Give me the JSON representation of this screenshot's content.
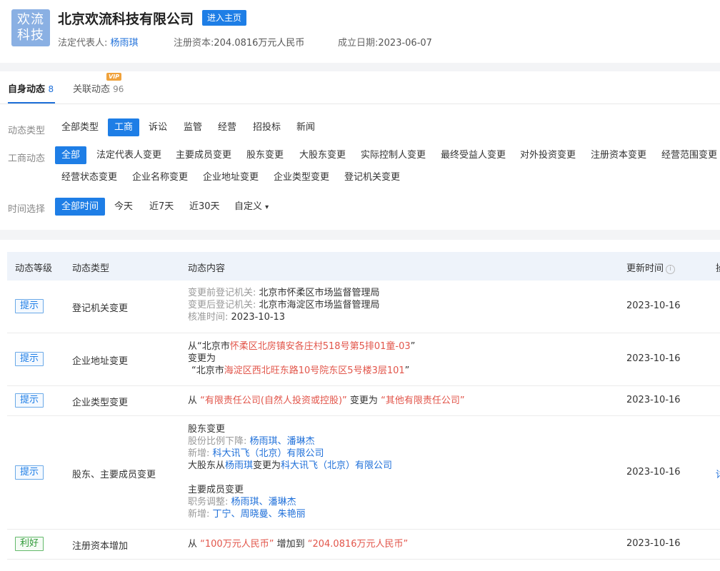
{
  "company": {
    "logo_line1": "欢流",
    "logo_line2": "科技",
    "name": "北京欢流科技有限公司",
    "home_button": "进入主页",
    "legal_rep_label": "法定代表人:",
    "legal_rep": "杨雨琪",
    "capital_label": "注册资本:",
    "capital": "204.0816万元人民币",
    "founded_label": "成立日期:",
    "founded": "2023-06-07"
  },
  "tabs": [
    {
      "label": "自身动态",
      "count": "8"
    },
    {
      "label": "关联动态",
      "count": "96",
      "badge": "VIP"
    }
  ],
  "filters": {
    "type_label": "动态类型",
    "types": [
      "全部类型",
      "工商",
      "诉讼",
      "监管",
      "经营",
      "招投标",
      "新闻"
    ],
    "type_selected": "工商",
    "biz_label": "工商动态",
    "biz_items": [
      "全部",
      "法定代表人变更",
      "主要成员变更",
      "股东变更",
      "大股东变更",
      "实际控制人变更",
      "最终受益人变更",
      "对外投资变更",
      "注册资本变更",
      "经营范围变更",
      "经营状态变更",
      "企业名称变更",
      "企业地址变更",
      "企业类型变更",
      "登记机关变更"
    ],
    "biz_selected": "全部",
    "time_label": "时间选择",
    "times": [
      "全部时间",
      "今天",
      "近7天",
      "近30天",
      "自定义"
    ],
    "time_selected": "全部时间",
    "custom_caret": "▾"
  },
  "table": {
    "headers": [
      "动态等级",
      "动态类型",
      "动态内容",
      "更新时间",
      "操"
    ],
    "rows": [
      {
        "level": "提示",
        "type": "登记机关变更",
        "time": "2023-10-16",
        "before_label": "变更前登记机关:",
        "before_value": "北京市怀柔区市场监督管理局",
        "after_label": "变更后登记机关:",
        "after_value": "北京市海淀区市场监督管理局",
        "approve_label": "核准时间:",
        "approve_value": "2023-10-13"
      },
      {
        "level": "提示",
        "type": "企业地址变更",
        "time": "2023-10-16",
        "from_word": "从",
        "from_prefix": "“北京市",
        "from_hl": "怀柔区北房镇安各庄村518号第5排01童-03",
        "from_suffix": "”",
        "change_to": "变更为",
        "to_prefix": "“北京市",
        "to_hl": "海淀区西北旺东路10号院东区5号楼3层101",
        "to_suffix": "”"
      },
      {
        "level": "提示",
        "type": "企业类型变更",
        "time": "2023-10-16",
        "from_word": "从",
        "from_value": "“有限责任公司(自然人投资或控股)”",
        "change_to": "变更为",
        "to_value": "“其他有限责任公司”"
      },
      {
        "level": "提示",
        "type": "股东、主要成员变更",
        "time": "2023-10-16",
        "action": "详",
        "shareholder_title": "股东变更",
        "ratio_down_label": "股份比例下降:",
        "ratio_down_a": "杨雨琪",
        "sep": "、",
        "ratio_down_b": "潘琳杰",
        "new_label": "新增:",
        "new_holder": "科大讯飞（北京）有限公司",
        "major_prefix": "大股东从",
        "major_from": "杨雨琪",
        "major_mid": "变更为",
        "major_to": "科大讯飞（北京）有限公司",
        "member_title": "主要成员变更",
        "duty_label": "职务调整:",
        "duty_a": "杨雨琪",
        "duty_b": "潘琳杰",
        "member_new_label": "新增:",
        "member_new_a": "丁宁",
        "member_new_b": "周晓曼",
        "member_new_c": "朱艳丽"
      },
      {
        "level": "利好",
        "type": "注册资本增加",
        "time": "2023-10-16",
        "from_word": "从",
        "from_value": "“100万元人民币”",
        "increase_to": "增加到",
        "to_value": "“204.0816万元人民币”"
      }
    ]
  },
  "colors": {
    "accent": "#1e7ee6",
    "highlight_red": "#e2554a",
    "good_green": "#2f9a37",
    "vip_orange": "#f0a23b"
  }
}
